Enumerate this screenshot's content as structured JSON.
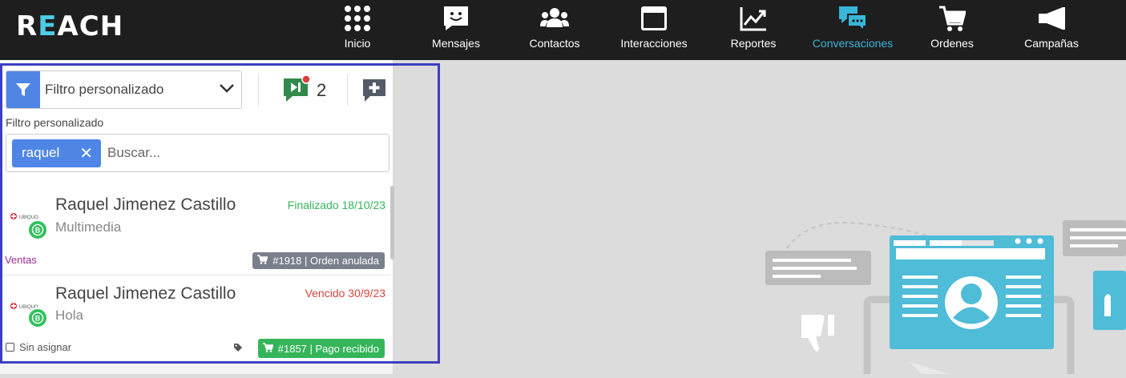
{
  "app": {
    "logo_pre": "R",
    "logo_e": "E",
    "logo_post": "ACH"
  },
  "nav": {
    "items": [
      {
        "label": "Inicio",
        "icon": "grid-icon"
      },
      {
        "label": "Mensajes",
        "icon": "smile-message-icon"
      },
      {
        "label": "Contactos",
        "icon": "users-icon"
      },
      {
        "label": "Interacciones",
        "icon": "window-icon"
      },
      {
        "label": "Reportes",
        "icon": "chart-line-icon"
      },
      {
        "label": "Conversaciones",
        "icon": "chat-bubbles-icon",
        "active": true
      },
      {
        "label": "Ordenes",
        "icon": "cart-icon"
      },
      {
        "label": "Campañas",
        "icon": "megaphone-icon"
      }
    ],
    "active_color": "#39b6d8"
  },
  "filter": {
    "selected": "Filtro personalizado",
    "label": "Filtro personalizado"
  },
  "queue": {
    "count": "2"
  },
  "search": {
    "chip": "raquel",
    "chip_close": "✕",
    "placeholder": "Buscar..."
  },
  "conversations": [
    {
      "name": "Raquel Jimenez Castillo",
      "preview": "Multimedia",
      "status": "Finalizado 18/10/23",
      "status_color": "#35b55a",
      "order": "#1918 | Orden anulada",
      "order_color": "#7a7f8c",
      "group": "Ventas",
      "avatar_text": "UBIQUO"
    },
    {
      "name": "Raquel Jimenez Castillo",
      "preview": "Hola",
      "status": "Vencido 30/9/23",
      "status_color": "#d9463a",
      "order": "#1857 | Pago recibido",
      "order_color": "#35b55a",
      "assignee": "Sin asignar",
      "avatar_text": "UBIQUO"
    }
  ]
}
